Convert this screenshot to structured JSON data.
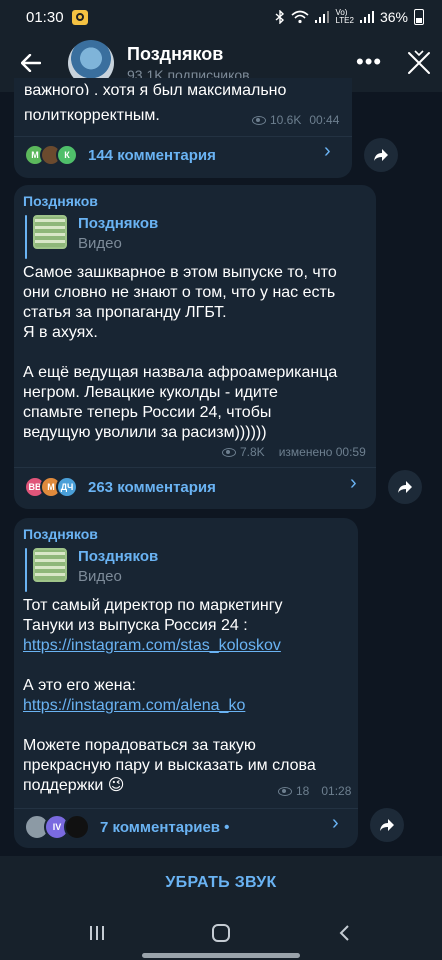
{
  "status_bar": {
    "time": "01:30",
    "network_label": "Vo)\nLTE2",
    "battery": "36%"
  },
  "header": {
    "title": "Поздняков",
    "subtitle": "93.1K подписчиков"
  },
  "messages": [
    {
      "text_partial_top": "важного) , хотя я был максимально",
      "text_last_line": "политкорректным.",
      "views": "10.6K",
      "time": "00:44",
      "comment_avatars": [
        "М",
        "",
        "К"
      ],
      "comments_label": "144 комментария"
    },
    {
      "sender": "Поздняков",
      "forward_name": "Поздняков",
      "forward_type": "Видео",
      "text": "Самое зашкварное в этом выпуске то, что\nони словно не знают о том, что у нас есть\nстатья за пропаганду ЛГБТ.\nЯ в ахуях.\n\nА ещё ведущая назвала афроамериканца\nнегром. Левацкие куколды - идите\nспамьте теперь России 24, чтобы\nведущую уволили за расизм))))))",
      "views": "7.8K",
      "time": "изменено 00:59",
      "comment_avatars": [
        "ВВ",
        "М",
        "ДЧ"
      ],
      "comments_label": "263 комментария"
    },
    {
      "sender": "Поздняков",
      "forward_name": "Поздняков",
      "forward_type": "Видео",
      "text_1": "Тот самый директор по маркетингу\nТануки из выпуска Россия 24 :",
      "link_1": "https://instagram.com/stas_koloskov",
      "text_2": "А это его жена:",
      "link_2": "https://instagram.com/alena_ko",
      "text_3": "Можете порадоваться за такую\nпрекрасную пару и высказать им слова\nподдержки 😉",
      "views": "18",
      "time": "01:28",
      "comment_avatars": [
        "",
        "IV",
        ""
      ],
      "comments_label": "7 комментариев •"
    }
  ],
  "mute_button": "УБРАТЬ ЗВУК",
  "colors": {
    "background": "#0e1621",
    "bubble": "#182533",
    "accent": "#6ab3f3",
    "meta": "#6d7f8f"
  },
  "icons": [
    "back-arrow-icon",
    "more-icon",
    "close-icon",
    "eye-icon",
    "chevron-right-icon",
    "share-icon"
  ]
}
